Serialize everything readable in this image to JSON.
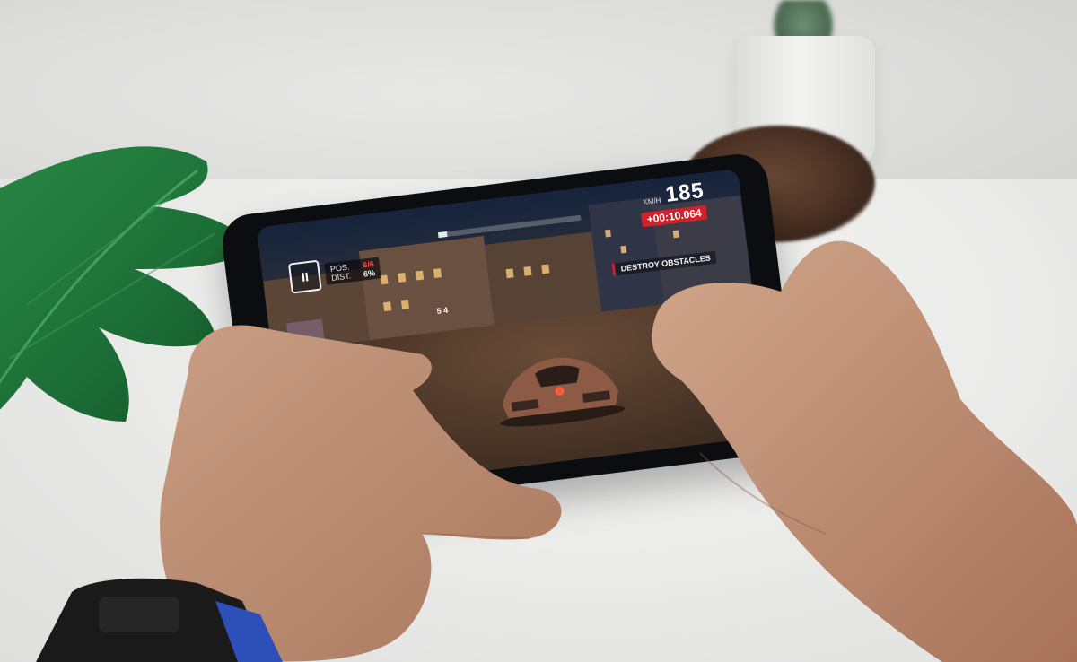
{
  "game_hud": {
    "pause_icon": "pause-icon",
    "pause_glyph": "II",
    "position_label": "POS.",
    "position_value": "6/6",
    "distance_label": "DIST.",
    "distance_value": "6%",
    "speed_unit": "KM/H",
    "speed_value": "185",
    "timer": "+00:10.064",
    "mission_text": "DESTROY OBSTACLES",
    "rival_tags": "5 4",
    "race_progress": 0.06
  },
  "colors": {
    "accent_red": "#d3202a",
    "leaf_green": "#1f7a3c",
    "phone_body": "#0c0d10",
    "watch_band": "#1a1a1a",
    "watch_accent": "#2d4fb8"
  }
}
